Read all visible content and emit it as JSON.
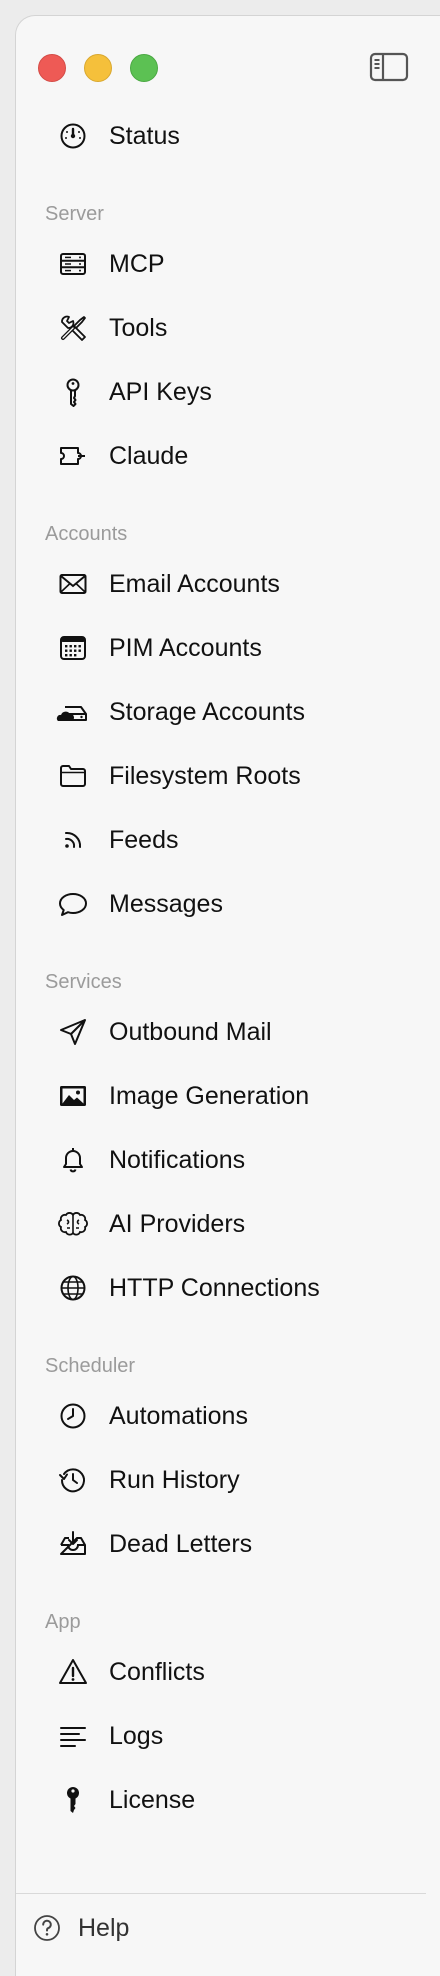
{
  "window": {
    "controls": [
      "close",
      "minimize",
      "zoom"
    ],
    "toggle_icon": "sidebar-toggle-icon"
  },
  "nav": {
    "status": {
      "label": "Status",
      "icon": "gauge-icon"
    },
    "sections": [
      {
        "title": "Server",
        "items": [
          {
            "label": "MCP",
            "icon": "server-icon"
          },
          {
            "label": "Tools",
            "icon": "tools-icon"
          },
          {
            "label": "API Keys",
            "icon": "key-icon"
          },
          {
            "label": "Claude",
            "icon": "puzzle-icon"
          }
        ]
      },
      {
        "title": "Accounts",
        "items": [
          {
            "label": "Email Accounts",
            "icon": "envelope-icon"
          },
          {
            "label": "PIM Accounts",
            "icon": "calendar-icon"
          },
          {
            "label": "Storage Accounts",
            "icon": "cloud-drive-icon"
          },
          {
            "label": "Filesystem Roots",
            "icon": "folder-icon"
          },
          {
            "label": "Feeds",
            "icon": "rss-icon"
          },
          {
            "label": "Messages",
            "icon": "speech-bubble-icon"
          }
        ]
      },
      {
        "title": "Services",
        "items": [
          {
            "label": "Outbound Mail",
            "icon": "paper-plane-icon"
          },
          {
            "label": "Image Generation",
            "icon": "photo-icon"
          },
          {
            "label": "Notifications",
            "icon": "bell-icon"
          },
          {
            "label": "AI Providers",
            "icon": "brain-icon"
          },
          {
            "label": "HTTP Connections",
            "icon": "globe-icon"
          }
        ]
      },
      {
        "title": "Scheduler",
        "items": [
          {
            "label": "Automations",
            "icon": "clock-icon"
          },
          {
            "label": "Run History",
            "icon": "history-icon"
          },
          {
            "label": "Dead Letters",
            "icon": "inbox-download-icon"
          }
        ]
      },
      {
        "title": "App",
        "items": [
          {
            "label": "Conflicts",
            "icon": "warning-icon"
          },
          {
            "label": "Logs",
            "icon": "text-lines-icon"
          },
          {
            "label": "License",
            "icon": "key-fill-icon"
          }
        ]
      }
    ]
  },
  "footer": {
    "help_label": "Help",
    "icon": "question-circle-icon"
  },
  "colors": {
    "close": "#ee5a55",
    "minimize": "#f5c03b",
    "zoom": "#5cc153",
    "section_header": "#9b9b9b",
    "text": "#111111",
    "sidebar_bg": "#f7f7f7"
  }
}
